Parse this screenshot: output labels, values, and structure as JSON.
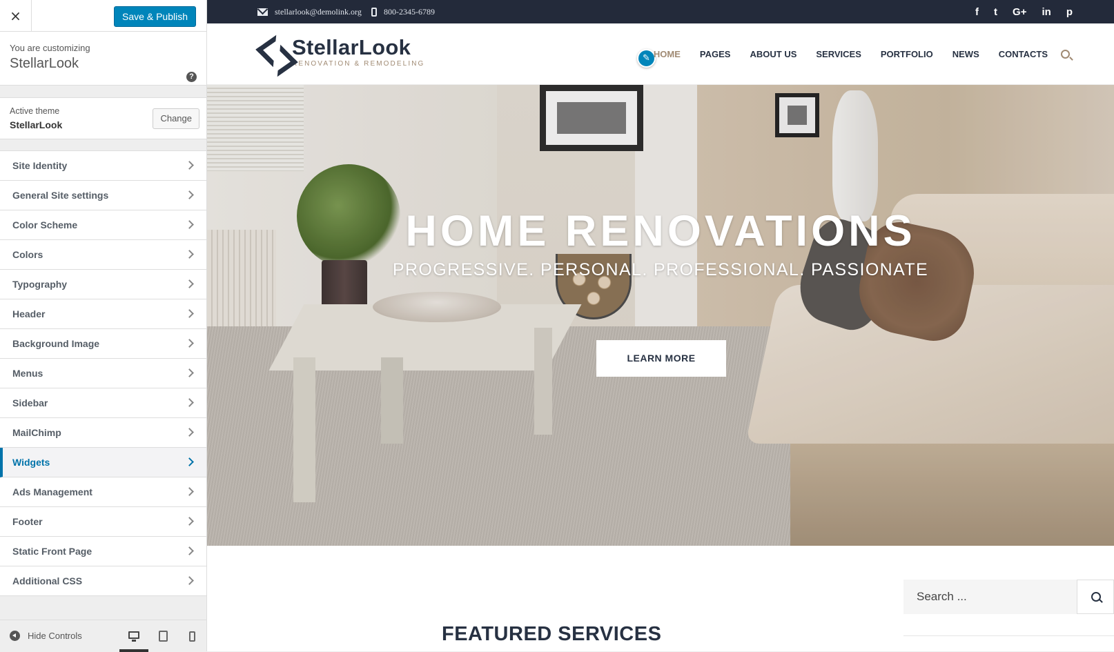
{
  "customizer": {
    "close_icon": "×",
    "publish_label": "Save & Publish",
    "info_label": "You are customizing",
    "site_title": "StellarLook",
    "help_icon": "?",
    "active_theme_label": "Active theme",
    "active_theme_name": "StellarLook",
    "change_label": "Change",
    "sections": [
      "Site Identity",
      "General Site settings",
      "Color Scheme",
      "Colors",
      "Typography",
      "Header",
      "Background Image",
      "Menus",
      "Sidebar",
      "MailChimp",
      "Widgets",
      "Ads Management",
      "Footer",
      "Static Front Page",
      "Additional CSS"
    ],
    "active_section": "Widgets",
    "hide_controls_label": "Hide Controls",
    "devices": [
      "desktop",
      "tablet",
      "mobile"
    ],
    "active_device": "desktop"
  },
  "site": {
    "topbar": {
      "email": "stellarlook@demolink.org",
      "phone": "800-2345-6789",
      "social": [
        "f",
        "t",
        "G+",
        "in",
        "p"
      ]
    },
    "logo": {
      "name": "StellarLook",
      "tagline": "RENOVATION & REMODELING"
    },
    "edit_icon": "✎",
    "nav": [
      "HOME",
      "PAGES",
      "ABOUT US",
      "SERVICES",
      "PORTFOLIO",
      "NEWS",
      "CONTACTS"
    ],
    "nav_current": "HOME",
    "hero": {
      "title": "HOME RENOVATIONS",
      "subtitle": "PROGRESSIVE. PERSONAL. PROFESSIONAL. PASSIONATE",
      "button": "LEARN MORE"
    },
    "search": {
      "placeholder": "Search ..."
    },
    "featured_title": "FEATURED SERVICES"
  },
  "colors": {
    "topbar_bg": "#232a3a",
    "accent": "#a08a73",
    "wp_blue": "#0085ba",
    "text_dark": "#273142"
  }
}
